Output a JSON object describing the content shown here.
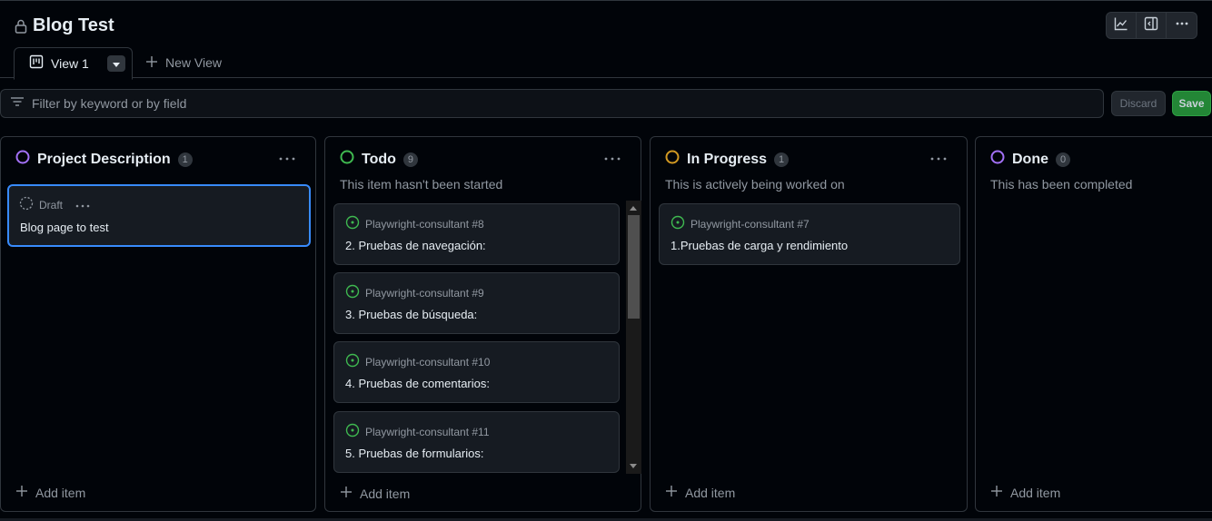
{
  "header": {
    "title": "Blog Test",
    "icons": [
      "lock-icon",
      "insights-icon",
      "sidepanel-icon",
      "kebab-icon"
    ]
  },
  "tabs": {
    "active": "View 1",
    "new_view": "New View"
  },
  "filter": {
    "placeholder": "Filter by keyword or by field",
    "discard": "Discard",
    "save": "Save"
  },
  "colors": {
    "purple": "#8957e5",
    "green": "#3fb950",
    "orange": "#d29922",
    "accent_blue": "#388bfd"
  },
  "columns": [
    {
      "name": "Project Description",
      "count": "1",
      "description": "",
      "add_item": "Add item",
      "cards": [
        {
          "meta": "Draft",
          "title": "Blog page to test"
        }
      ]
    },
    {
      "name": "Todo",
      "count": "9",
      "description": "This item hasn't been started",
      "add_item": "Add item",
      "cards": [
        {
          "meta": "Playwright-consultant #8",
          "title": "2. Pruebas de navegación:"
        },
        {
          "meta": "Playwright-consultant #9",
          "title": "3. Pruebas de búsqueda:"
        },
        {
          "meta": "Playwright-consultant #10",
          "title": "4. Pruebas de comentarios:"
        },
        {
          "meta": "Playwright-consultant #11",
          "title": "5. Pruebas de formularios:"
        }
      ]
    },
    {
      "name": "In Progress",
      "count": "1",
      "description": "This is actively being worked on",
      "add_item": "Add item",
      "cards": [
        {
          "meta": "Playwright-consultant #7",
          "title": "1.Pruebas de carga y rendimiento"
        }
      ]
    },
    {
      "name": "Done",
      "count": "0",
      "description": "This has been completed",
      "add_item": "Add item",
      "cards": []
    }
  ]
}
